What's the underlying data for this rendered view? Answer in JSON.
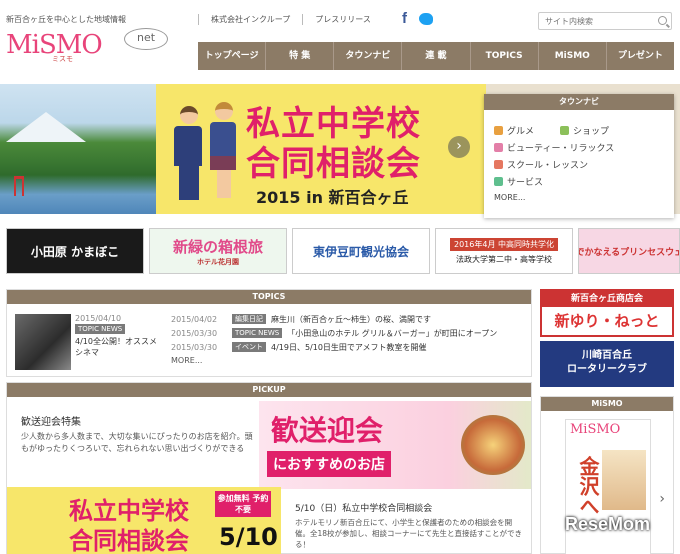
{
  "header": {
    "tagline": "新百合ヶ丘を中心とした地域情報",
    "logo": "MiSMO",
    "logo_sub": "ミスモ",
    "logo_net": "net",
    "top_links": [
      "株式会社インクループ",
      "プレスリリース"
    ],
    "search_placeholder": "サイト内検索"
  },
  "nav": [
    "トップページ",
    "特 集",
    "タウンナビ",
    "連 載",
    "TOPICS",
    "MiSMO",
    "プレゼント"
  ],
  "hero": {
    "title_line1": "私立中学校",
    "title_line2": "合同相談会",
    "subtitle": "2015 in 新百合ヶ丘",
    "next_arrow": "›"
  },
  "townnavi": {
    "title": "タウンナビ",
    "items": [
      {
        "label": "グルメ",
        "color": "#e8a040"
      },
      {
        "label": "ショップ",
        "color": "#8cc05a"
      },
      {
        "label": "ビューティー・リラックス",
        "color": "#e37fa8"
      },
      {
        "label": "スクール・レッスン",
        "color": "#e57760"
      },
      {
        "label": "サービス",
        "color": "#5fbf8e"
      }
    ],
    "more": "MORE..."
  },
  "banners": {
    "b1": "小田原 かまぼこ",
    "b2_main": "新緑の箱根旅",
    "b2_sub": "ホテル花月園",
    "b3": "東伊豆町観光協会",
    "b4_top": "2016年4月 中高同時共学化",
    "b4_main": "法政大学第二中・高等学校",
    "b5": "お城でかなえるプリンセスウェディ"
  },
  "topics": {
    "title": "TOPICS",
    "featured": {
      "date": "2015/04/10",
      "badge": "TOPIC NEWS",
      "title": "4/10全公開！オススメシネマ"
    },
    "items": [
      {
        "date": "2015/04/02",
        "badge": "編集日記",
        "text": "麻生川（新百合ヶ丘～柿生）の桜、満開です"
      },
      {
        "date": "2015/03/30",
        "badge": "TOPIC NEWS",
        "text": "「小田急山のホテル グリル＆バーガー」が町田にオープン"
      },
      {
        "date": "2015/03/30",
        "badge": "イベント",
        "text": "4/19日、5/10日生田でアメフト教室を開催"
      }
    ],
    "more": "MORE..."
  },
  "pickup": {
    "title": "PICKUP",
    "item1": {
      "title": "歓送迎会特集",
      "desc": "少人数から多人数まで、大切な集いにぴったりのお店を紹介。頭もがゆったりくつろいで、忘れられない思い出づくりができる",
      "img_title": "歓送迎会",
      "img_sub": "におすすめのお店"
    },
    "item2": {
      "title": "5/10（日）私立中学校合同相談会",
      "desc": "ホテルモリノ新百合丘にて、小学生と保護者のための相談会を開催。全18校が参加し、相談コーナーにて先生と直接話すことができる！",
      "img_a": "私立中学校",
      "img_b": "合同相談会",
      "img_badge": "参加無料 予約不要",
      "img_date": "5/10"
    }
  },
  "right": {
    "rb1_top": "新百合ヶ丘商店会",
    "rb1_main": "新ゆり・ねっと",
    "rb2_line1": "川崎百合丘",
    "rb2_line2": "ロータリークラブ",
    "mismo_title": "MiSMO",
    "cover_logo": "MiSMO",
    "cover_headline": "金沢へ",
    "next": "›"
  },
  "watermark": "ReseMom"
}
